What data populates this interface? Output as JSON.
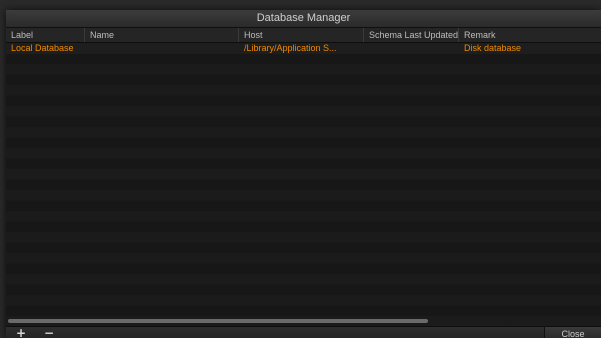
{
  "window": {
    "title": "Database Manager"
  },
  "table": {
    "columns": [
      "Label",
      "Name",
      "Host",
      "Schema Last Updated",
      "Remark"
    ],
    "rows": [
      {
        "label": "Local Database",
        "name": "",
        "host": "/Library/Application S...",
        "schema_last_updated": "",
        "remark": "Disk database"
      }
    ]
  },
  "footer": {
    "add_icon": "plus-icon",
    "add_glyph": "+",
    "remove_icon": "minus-icon",
    "remove_glyph": "−",
    "close_label": "Close"
  },
  "colors": {
    "row_text": "#f08a00",
    "window_bg": "#151515"
  }
}
